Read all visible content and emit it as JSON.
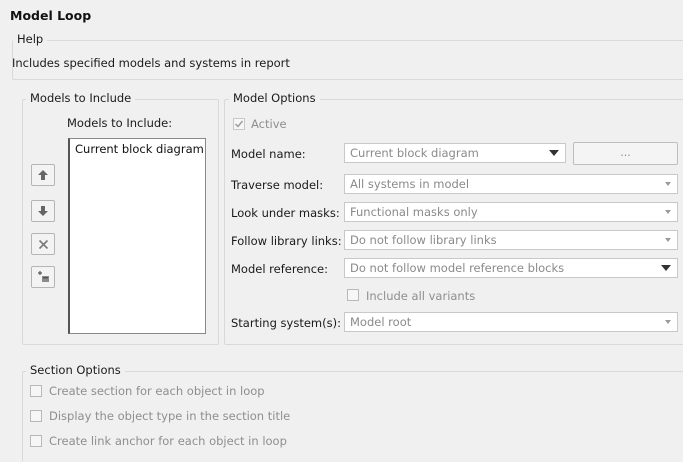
{
  "title": "Model Loop",
  "help": {
    "legend": "Help",
    "text": "Includes specified models and systems in report"
  },
  "models_group": {
    "legend": "Models to Include",
    "list_label": "Models to Include:",
    "items": [
      "Current block diagram"
    ],
    "buttons": [
      "move-up-icon",
      "move-down-icon",
      "delete-icon",
      "add-icon"
    ]
  },
  "model_options": {
    "legend": "Model Options",
    "active_label": "Active",
    "active_checked": true,
    "model_name_label": "Model name:",
    "model_name_value": "Current block diagram",
    "browse_label": "...",
    "traverse_label": "Traverse model:",
    "traverse_value": "All systems in model",
    "masks_label": "Look under masks:",
    "masks_value": "Functional masks only",
    "library_label": "Follow library links:",
    "library_value": "Do not follow library links",
    "modelref_label": "Model reference:",
    "modelref_value": "Do not follow model reference blocks",
    "variants_label": "Include all variants",
    "variants_checked": false,
    "starting_label": "Starting system(s):",
    "starting_value": "Model root"
  },
  "section_options": {
    "legend": "Section Options",
    "items": [
      {
        "label": "Create section for each object in loop",
        "checked": false
      },
      {
        "label": "Display the object type in the section title",
        "checked": false
      },
      {
        "label": "Create link anchor for each object in loop",
        "checked": false
      }
    ]
  }
}
